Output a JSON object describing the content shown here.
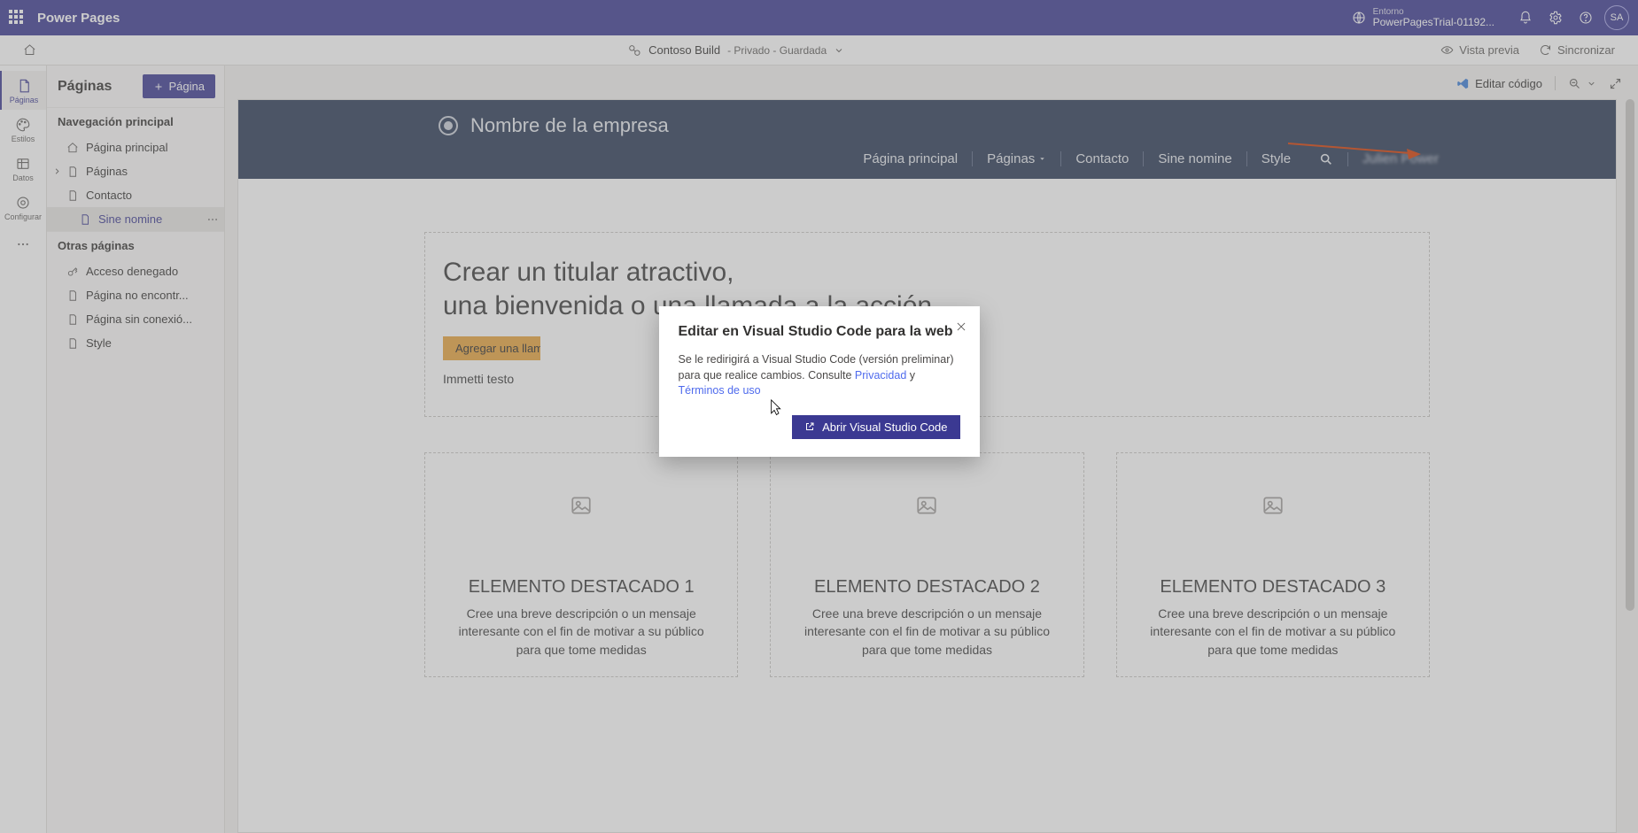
{
  "topbar": {
    "product": "Power Pages",
    "env_label": "Entorno",
    "env_name": "PowerPagesTrial-01192...",
    "avatar_initials": "SA"
  },
  "subbar": {
    "site_name": "Contoso Build",
    "state": "- Privado - Guardada",
    "preview": "Vista previa",
    "sync": "Sincronizar"
  },
  "rail": {
    "items": [
      {
        "label": "Páginas"
      },
      {
        "label": "Estilos"
      },
      {
        "label": "Datos"
      },
      {
        "label": "Configurar"
      }
    ]
  },
  "sidepanel": {
    "title": "Páginas",
    "new_page": "Página",
    "section_main": "Navegación principal",
    "section_other": "Otras páginas",
    "main_items": [
      {
        "label": "Página principal"
      },
      {
        "label": "Páginas"
      },
      {
        "label": "Contacto"
      },
      {
        "label": "Sine nomine"
      }
    ],
    "other_items": [
      {
        "label": "Acceso denegado"
      },
      {
        "label": "Página no encontr..."
      },
      {
        "label": "Página sin conexió..."
      },
      {
        "label": "Style"
      }
    ]
  },
  "tools": {
    "edit_code": "Editar código"
  },
  "preview": {
    "brand": "Nombre de la empresa",
    "nav": {
      "home": "Página principal",
      "pages": "Páginas",
      "contact": "Contacto",
      "sine": "Sine nomine",
      "style": "Style",
      "user": "Julien Power"
    },
    "hero_line1": "Crear un titular atractivo,",
    "hero_line2": "una bienvenida o una llamada a la acción",
    "cta": "Agregar una llam",
    "subtext": "Immetti testo",
    "features": [
      {
        "title": "ELEMENTO DESTACADO 1",
        "desc": "Cree una breve descripción o un mensaje interesante con el fin de motivar a su público para que tome medidas"
      },
      {
        "title": "ELEMENTO DESTACADO 2",
        "desc": "Cree una breve descripción o un mensaje interesante con el fin de motivar a su público para que tome medidas"
      },
      {
        "title": "ELEMENTO DESTACADO 3",
        "desc": "Cree una breve descripción o un mensaje interesante con el fin de motivar a su público para que tome medidas"
      }
    ]
  },
  "dialog": {
    "title": "Editar en Visual Studio Code para la web",
    "body_pre": "Se le redirigirá a Visual Studio Code (versión preliminar) para que realice cambios. Consulte ",
    "privacy": "Privacidad",
    "and": " y ",
    "terms": "Términos de uso",
    "action": "Abrir Visual Studio Code"
  }
}
